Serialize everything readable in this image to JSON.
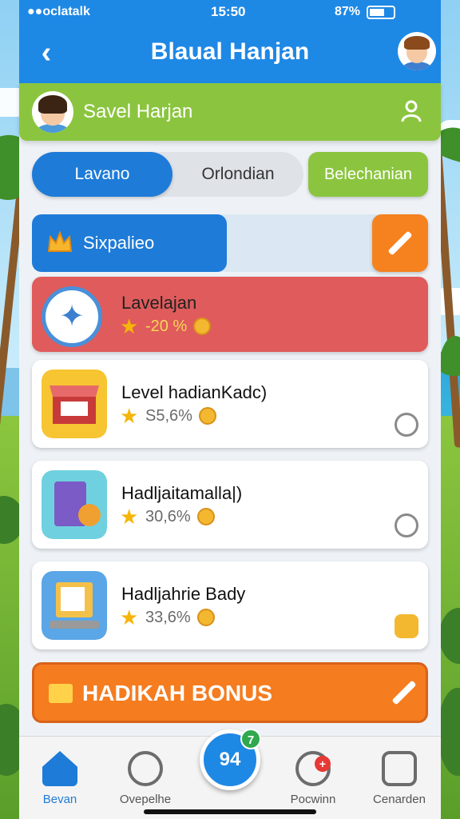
{
  "status": {
    "carrier": "●●oclatalk",
    "time": "15:50",
    "battery": "87%"
  },
  "header": {
    "title": "Blaual Hanjan",
    "back_icon": "chevron-left-icon"
  },
  "user": {
    "name": "Savel Harjan",
    "icon": "person-icon"
  },
  "tabs": [
    {
      "label": "Lavano",
      "active": true
    },
    {
      "label": "Orlondian",
      "active": false
    }
  ],
  "tab_extra": {
    "label": "Belechanian"
  },
  "section": {
    "label": "Sixpalieo",
    "icon": "crown-icon",
    "edit_icon": "pencil-icon"
  },
  "cards": [
    {
      "title": "Lavelajan",
      "meta": "-20 %",
      "variant": "red"
    },
    {
      "title": "Level hadianKadc)",
      "meta": "S5,6%"
    },
    {
      "title": "Hadljaitamalla|)",
      "meta": "30,6%"
    },
    {
      "title": "Hadljahrie Bady",
      "meta": "33,6%"
    }
  ],
  "bonus": {
    "label": "HADIKAH BONUS",
    "icon": "ticket-icon"
  },
  "fab": {
    "label": "94",
    "badge": "7"
  },
  "nav": [
    {
      "label": "Bevan",
      "icon": "home-icon",
      "active": true
    },
    {
      "label": "Ovepelhe",
      "icon": "people-icon",
      "active": false
    },
    {
      "label": "Pocwinn",
      "icon": "chat-icon",
      "active": false,
      "badge": "+"
    },
    {
      "label": "Cenarden",
      "icon": "settings-icon",
      "active": false
    }
  ],
  "colors": {
    "primary": "#1e88e5",
    "green": "#8bc53f",
    "orange": "#f5821f",
    "red": "#e05b5b"
  }
}
